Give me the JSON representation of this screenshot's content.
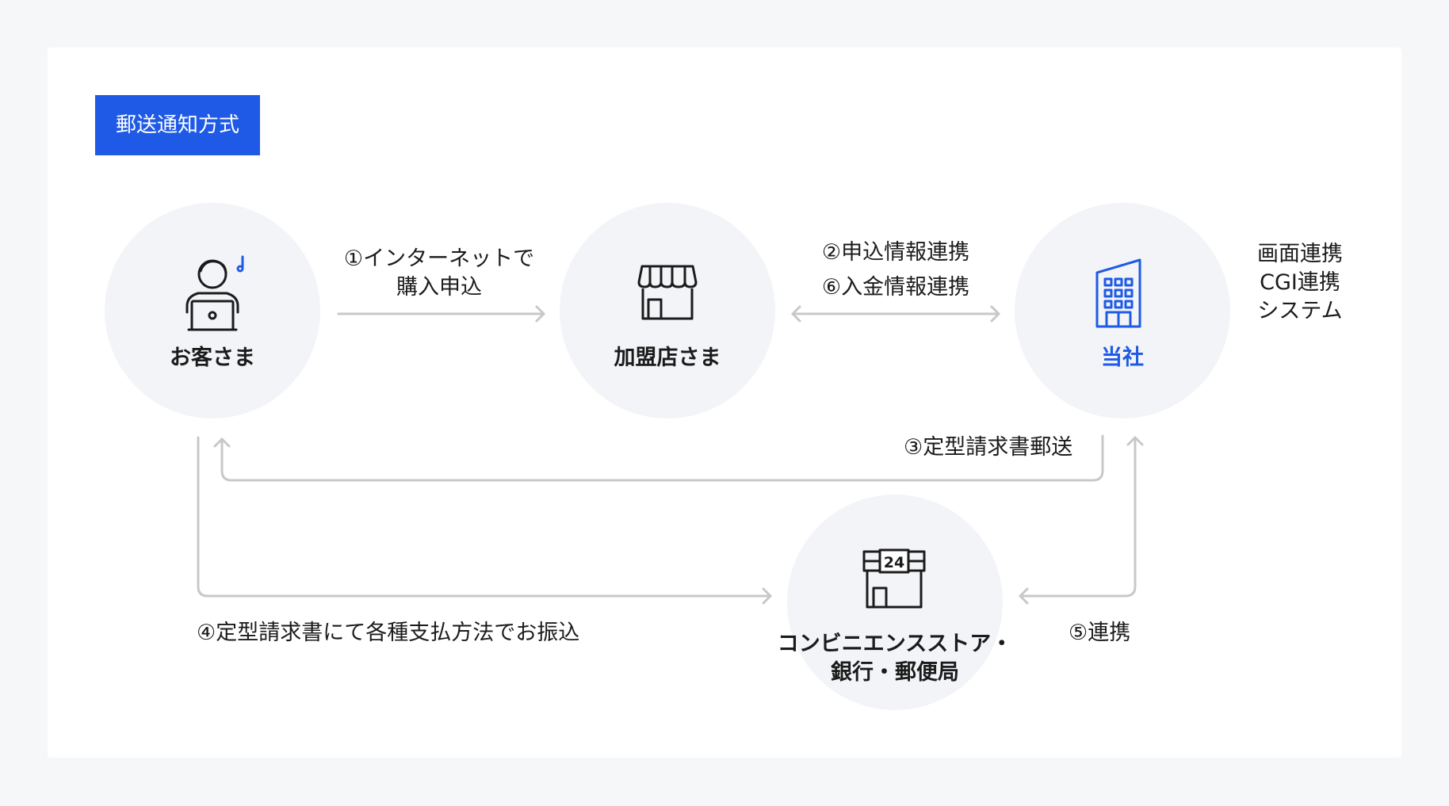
{
  "badge": "郵送通知方式",
  "nodes": {
    "customer": "お客さま",
    "merchant": "加盟店さま",
    "company": "当社",
    "store": [
      "コンビニエンスストア・",
      "銀行・郵便局"
    ]
  },
  "arrows": {
    "step1": [
      "①インターネットで",
      "購入申込"
    ],
    "step2": "②申込情報連携",
    "step6": "⑥入金情報連携",
    "step3": "③定型請求書郵送",
    "step4": "④定型請求書にて各種支払方法でお振込",
    "step5": "⑤連携"
  },
  "systems": [
    "画面連携",
    "CGI連携",
    "システム"
  ],
  "store_icon_number": "24",
  "colors": {
    "accent": "#1f5ae6",
    "line": "#c8c8c8"
  }
}
